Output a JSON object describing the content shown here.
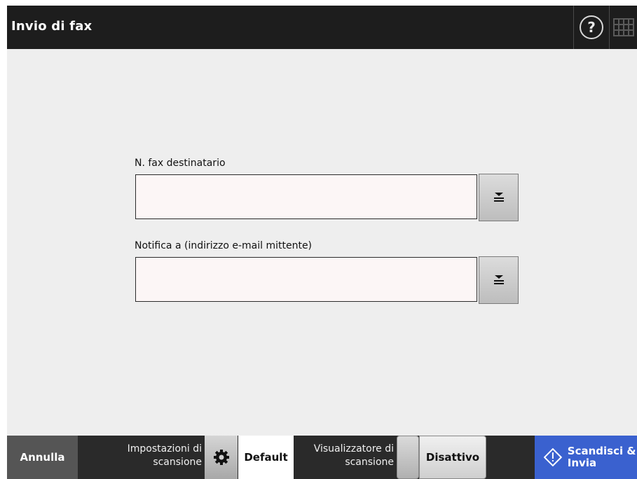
{
  "header": {
    "title": "Invio di fax",
    "help_icon": "question-mark-icon",
    "keyboard_icon": "keyboard-icon"
  },
  "form": {
    "fax_number": {
      "label": "N. fax destinatario",
      "value": ""
    },
    "notify": {
      "label": "Notifica a (indirizzo e-mail mittente)",
      "value": ""
    },
    "dropdown_icon": "list-selector-icon"
  },
  "footer": {
    "cancel_label": "Annulla",
    "scan_settings": {
      "label_line1": "Impostazioni di",
      "label_line2": "scansione",
      "value": "Default",
      "icon": "gear-icon"
    },
    "scan_viewer": {
      "label_line1": "Visualizzatore di",
      "label_line2": "scansione",
      "value": "Disattivo"
    },
    "scan_send": {
      "label_line1": "Scandisci &",
      "label_line2": "Invia",
      "icon": "start-diamond-icon"
    }
  },
  "colors": {
    "titlebar": "#1d1d1d",
    "background": "#eeeeee",
    "accent": "#3a61cf",
    "input_bg": "#fcf6f6"
  }
}
